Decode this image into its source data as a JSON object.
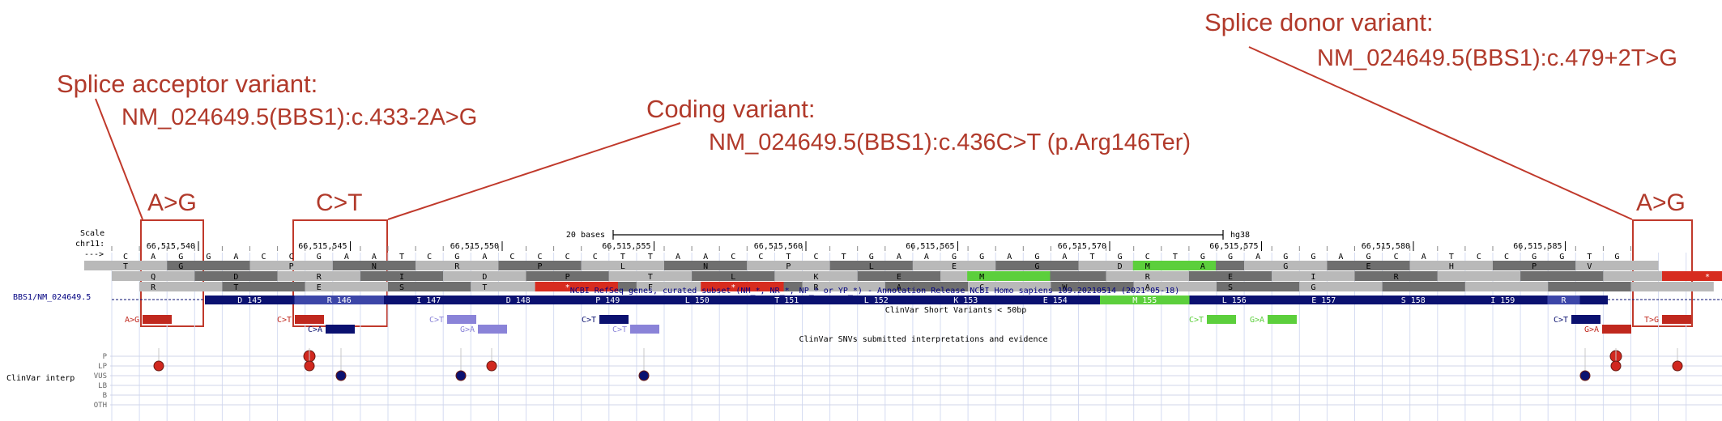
{
  "annotations": {
    "acceptor_title": "Splice acceptor variant:",
    "acceptor_hgvs": "NM_024649.5(BBS1):c.433-2A>G",
    "coding_title": "Coding variant:",
    "coding_hgvs": "NM_024649.5(BBS1):c.436C>T (p.Arg146Ter)",
    "donor_title": "Splice donor variant:",
    "donor_hgvs": "NM_024649.5(BBS1):c.479+2T>G",
    "box1_label": "A>G",
    "box2_label": "C>T",
    "box3_label": "A>G"
  },
  "browser": {
    "scale_label": "Scale",
    "chrom_label": "chr11:",
    "strand_label": "--->",
    "scale_text": "20 bases",
    "assembly": "hg38",
    "positions": [
      "66,515,540",
      "66,515,545",
      "66,515,550",
      "66,515,555",
      "66,515,560",
      "66,515,565",
      "66,515,570",
      "66,515,575",
      "66,515,580",
      "66,515,585"
    ],
    "sequence": [
      "C",
      "A",
      "G",
      "G",
      "A",
      "C",
      "C",
      "G",
      "A",
      "A",
      "T",
      "C",
      "G",
      "A",
      "C",
      "C",
      "C",
      "C",
      "T",
      "T",
      "A",
      "A",
      "C",
      "C",
      "T",
      "C",
      "T",
      "G",
      "A",
      "A",
      "G",
      "G",
      "A",
      "G",
      "A",
      "T",
      "G",
      "C",
      "T",
      "G",
      "G",
      "A",
      "G",
      "G",
      "A",
      "G",
      "C",
      "A",
      "T",
      "C",
      "C",
      "G",
      "G",
      "T",
      "G"
    ],
    "frame1": [
      "T",
      "",
      "G",
      "",
      "",
      "",
      "P",
      "",
      "",
      "N",
      "",
      "",
      "R",
      "",
      "",
      "P",
      "",
      "",
      "L",
      "",
      "",
      "N",
      "",
      "",
      "P",
      "",
      "",
      "L",
      "",
      "",
      "E",
      "",
      "",
      "G",
      "",
      "",
      "D",
      "M",
      "",
      "A",
      "",
      "",
      "G",
      "",
      "",
      "E",
      "",
      "",
      "H",
      "",
      "",
      "P",
      "",
      "V"
    ],
    "frame2": [
      "",
      "Q",
      "",
      "",
      "D",
      "",
      "",
      "R",
      "",
      "",
      "I",
      "",
      "",
      "D",
      "",
      "",
      "P",
      "",
      "",
      "T",
      "",
      "",
      "L",
      "",
      "",
      "K",
      "",
      "",
      "E",
      "",
      "",
      "M",
      "",
      "",
      "",
      "",
      "",
      "R",
      "",
      "",
      "E",
      "",
      "",
      "I",
      "",
      "",
      "R",
      "",
      ""
    ],
    "frame3": [
      "",
      "R",
      "",
      "",
      "T",
      "",
      "",
      "E",
      "",
      "",
      "S",
      "",
      "",
      "T",
      "",
      "",
      "*",
      "",
      "",
      "F",
      "",
      "",
      "*",
      "",
      "",
      "R",
      "",
      "",
      "A",
      "",
      "",
      "C",
      "",
      "",
      "W",
      "",
      "",
      "A",
      "",
      "",
      "S",
      "",
      "",
      "G",
      ""
    ],
    "refseq_title": "NCBI RefSeq genes, curated subset (NM_*, NR_*, NP_* or YP_*) - Annotation Release NCBI Homo sapiens 109.20210514 (2021-05-18)",
    "gene_label": "BBS1/NM_024649.5",
    "codons": [
      "D 145",
      "R 146",
      "I 147",
      "D 148",
      "P 149",
      "L 150",
      "T 151",
      "L 152",
      "K 153",
      "E 154",
      "M 155",
      "L 156",
      "E 157",
      "S 158",
      "I 159",
      "R"
    ],
    "short_variants_title": "ClinVar Short Variants < 50bp",
    "snv_title": "ClinVar SNVs submitted interpretations and evidence",
    "clinvar_label": "ClinVar interp",
    "interp_rows": [
      "P",
      "LP",
      "VUS",
      "LB",
      "B",
      "OTH"
    ],
    "variant_labels": {
      "v1": "A>G",
      "v2": "C>T",
      "v3": "C>A",
      "v4": "C>T",
      "v5": "G>A",
      "v6": "C>T",
      "v7": "C>T",
      "v8": "C>T",
      "v9": "G>A",
      "v10": "C>T",
      "v11": "G>A",
      "v12": "T>G"
    },
    "colors": {
      "annotation_red": "#b13a2b",
      "pathogenic_red": "#c0281e",
      "navy": "#0b1170",
      "lavender": "#8a83d8",
      "green": "#5ccf3c",
      "gray_dark": "#6f6f6f",
      "gray_light": "#b9b9b9",
      "nav_blue": "#000080"
    }
  }
}
